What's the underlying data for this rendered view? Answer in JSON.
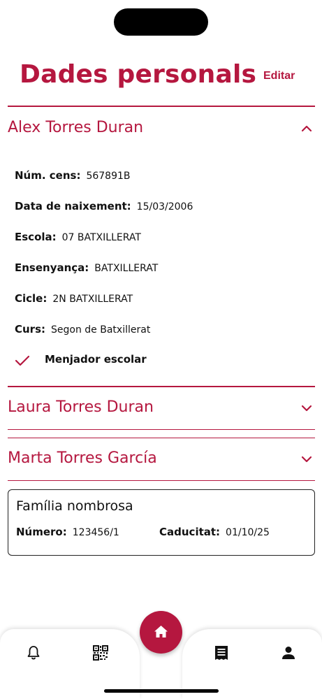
{
  "header": {
    "title": "Dades personals",
    "edit_label": "Editar"
  },
  "people": [
    {
      "name": "Alex Torres Duran",
      "expanded": true,
      "fields": [
        {
          "label": "Núm. cens:",
          "value": "567891B"
        },
        {
          "label": "Data de naixement:",
          "value": "15/03/2006"
        },
        {
          "label": "Escola:",
          "value": "07 BATXILLERAT"
        },
        {
          "label": "Ensenyança:",
          "value": "BATXILLERAT"
        },
        {
          "label": "Cicle:",
          "value": "2N BATXILLERAT"
        },
        {
          "label": "Curs:",
          "value": "Segon de Batxillerat"
        }
      ],
      "check_label": "Menjador escolar"
    },
    {
      "name": "Laura Torres Duran",
      "expanded": false
    },
    {
      "name": "Marta Torres García",
      "expanded": false
    }
  ],
  "family_card": {
    "title": "Família nombrosa",
    "number_label": "Número:",
    "number_value": "123456/1",
    "expiry_label": "Caducitat:",
    "expiry_value": "01/10/25"
  },
  "tabbar": {
    "items": [
      {
        "icon": "bell-icon"
      },
      {
        "icon": "qr-code-icon"
      },
      {
        "icon": "home-icon"
      },
      {
        "icon": "receipt-icon"
      },
      {
        "icon": "person-icon"
      }
    ]
  },
  "colors": {
    "accent": "#b5173f",
    "text": "#111111"
  }
}
